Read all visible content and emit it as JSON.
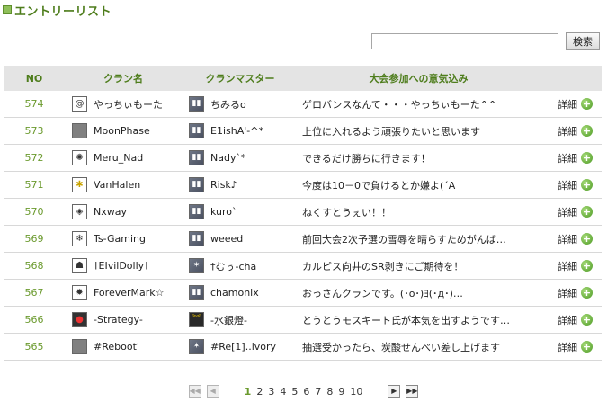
{
  "section_title": "エントリーリスト",
  "search": {
    "placeholder": "",
    "button_label": "検索"
  },
  "table": {
    "headers": {
      "no": "NO",
      "clan": "クラン名",
      "master": "クランマスター",
      "message": "大会参加への意気込み"
    },
    "detail_label": "詳細",
    "rows": [
      {
        "no": "574",
        "clan": "やっちぃもーた",
        "master": "ちみるo",
        "message": "ゲロバンスなんて・・・やっちぃもーた^^",
        "clan_icon": "swirl-emblem-icon",
        "master_icon": "rank-stripes-icon"
      },
      {
        "no": "573",
        "clan": "MoonPhase",
        "master": "E1ishA'-^*",
        "message": "上位に入れるよう頑張りたいと思います",
        "clan_icon": "gray-emblem-icon",
        "master_icon": "rank-stripes-icon"
      },
      {
        "no": "572",
        "clan": "Meru_Nad",
        "master": "Nady`*",
        "message": "できるだけ勝ちに行きます！",
        "clan_icon": "triskelion-emblem-icon",
        "master_icon": "rank-stripes-icon"
      },
      {
        "no": "571",
        "clan": "VanHalen",
        "master": "Risk♪",
        "message": "今度は10－0で負けるとか嫌よ(´A",
        "clan_icon": "star-emblem-icon",
        "master_icon": "rank-stripes-icon"
      },
      {
        "no": "570",
        "clan": "Nxway",
        "master": "kuro`",
        "message": "ねくすとうぇい！！",
        "clan_icon": "diamond-emblem-icon",
        "master_icon": "rank-stripes-icon"
      },
      {
        "no": "569",
        "clan": "Ts-Gaming",
        "master": "weeed",
        "message": "前回大会2次予選の雪辱を晴らすためがんば…",
        "clan_icon": "snowflake-emblem-icon",
        "master_icon": "rank-stripes-icon"
      },
      {
        "no": "568",
        "clan": "†EIvilDolly†",
        "master": "†むぅ-cha",
        "message": "カルピス向井のSR剥きにご期待を！",
        "clan_icon": "figure-emblem-icon",
        "master_icon": "rank-star-icon"
      },
      {
        "no": "567",
        "clan": "ForeverMark☆",
        "master": "chamonix",
        "message": "おっさんクランです。(･o･)ﾖ(･д･)…",
        "clan_icon": "splat-emblem-icon",
        "master_icon": "rank-stripes-icon"
      },
      {
        "no": "566",
        "clan": "-Strategy-",
        "master": "-水銀燈-",
        "message": "とうとうモスキート氏が本気を出すようです…",
        "clan_icon": "red-emblem-icon",
        "master_icon": "rank-chevron-icon"
      },
      {
        "no": "565",
        "clan": "#Reboot'",
        "master": "#Re[1]..ivory",
        "message": "抽選受かったら、炭酸せんべい差し上げます",
        "clan_icon": "gray-emblem-icon",
        "master_icon": "rank-star-icon"
      }
    ]
  },
  "pagination": {
    "pages": [
      "1",
      "2",
      "3",
      "4",
      "5",
      "6",
      "7",
      "8",
      "9",
      "10"
    ],
    "current": "1"
  }
}
